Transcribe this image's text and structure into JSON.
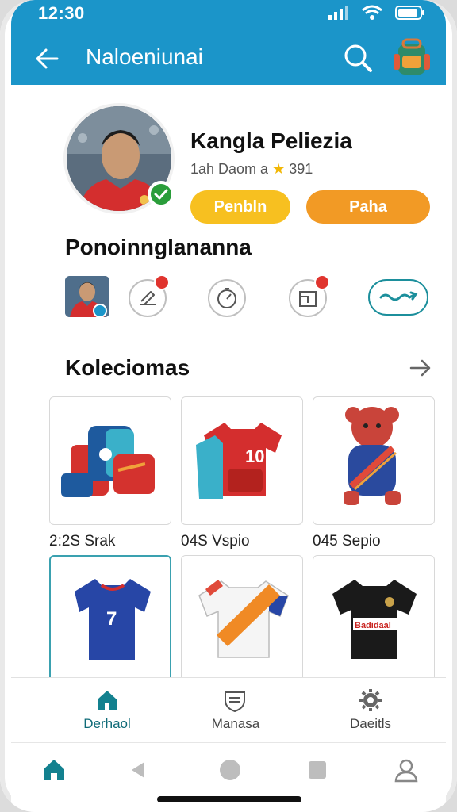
{
  "status_bar": {
    "time": "12:30"
  },
  "header": {
    "title": "Naloeniunai"
  },
  "profile": {
    "name": "Kangla Peliezia",
    "meta": "1ah Daom a",
    "rating": "391",
    "primary_button": "Penbln",
    "secondary_button": "Paha"
  },
  "shortcuts_section": {
    "title": "Ponoinnglananna",
    "items": [
      {
        "icon": "edit-icon",
        "badge": true
      },
      {
        "icon": "timer-icon",
        "badge": false
      },
      {
        "icon": "box-icon",
        "badge": true
      },
      {
        "icon": "tag-icon",
        "badge": false
      }
    ]
  },
  "collections": {
    "title": "Koleciomas",
    "items": [
      {
        "icon": "bags-icon",
        "label": "2:2S Srak"
      },
      {
        "icon": "jersey-red-icon",
        "label": "04S Vspio"
      },
      {
        "icon": "bear-icon",
        "label": "045 Sepio"
      },
      {
        "icon": "jersey-blue-icon",
        "label": ""
      },
      {
        "icon": "jersey-white-icon",
        "label": ""
      },
      {
        "icon": "jersey-black-icon",
        "label": "",
        "jersey_text": "Badidaal"
      }
    ],
    "jersey_number_red": "10",
    "jersey_number_blue": "7"
  },
  "tabs": [
    {
      "label": "Derhaol",
      "active": true
    },
    {
      "label": "Manasa",
      "active": false
    },
    {
      "label": "Daeitls",
      "active": false
    }
  ],
  "colors": {
    "primary": "#1b95c9",
    "accent": "#f29a25",
    "yellow": "#f7c020",
    "teal": "#0f6b78"
  }
}
